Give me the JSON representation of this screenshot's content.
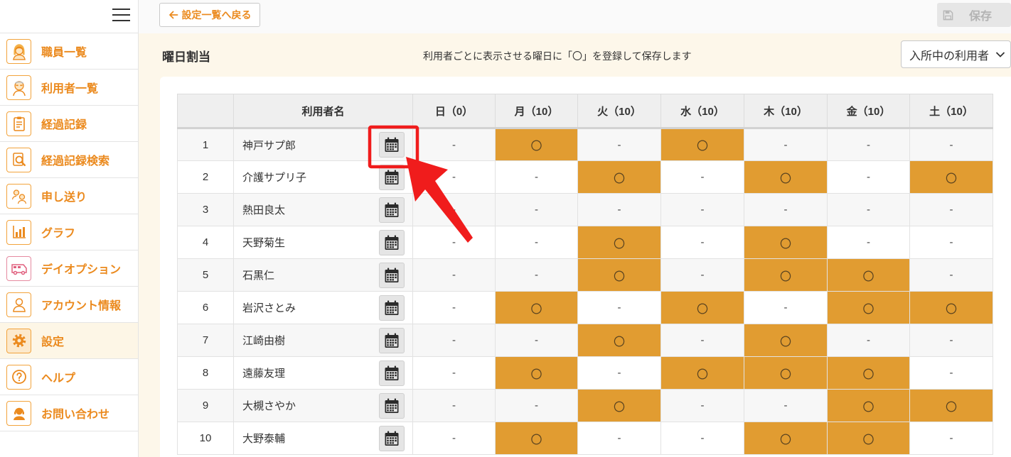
{
  "sidebar": {
    "menu_icon": "hamburger-icon",
    "items": [
      {
        "label": "職員一覧",
        "icon": "staff-icon"
      },
      {
        "label": "利用者一覧",
        "icon": "user-icon"
      },
      {
        "label": "経過記録",
        "icon": "clipboard-icon"
      },
      {
        "label": "経過記録検索",
        "icon": "record-search-icon"
      },
      {
        "label": "申し送り",
        "icon": "handover-icon"
      },
      {
        "label": "グラフ",
        "icon": "graph-icon"
      },
      {
        "label": "デイオプション",
        "icon": "van-icon"
      },
      {
        "label": "アカウント情報",
        "icon": "account-icon"
      },
      {
        "label": "設定",
        "icon": "gear-icon",
        "active": true
      },
      {
        "label": "ヘルプ",
        "icon": "help-icon"
      },
      {
        "label": "お問い合わせ",
        "icon": "contact-icon"
      }
    ]
  },
  "topbar": {
    "back_label": "設定一覧へ戻る",
    "back_icon": "arrow-left-icon",
    "save_label": "保存",
    "save_icon": "save-icon",
    "save_disabled": true
  },
  "page": {
    "title": "曜日割当",
    "description": "利用者ごとに表示させる曜日に「〇」を登録して保存します",
    "filter_selected": "入所中の利用者",
    "filter_icon": "chevron-down-icon"
  },
  "table": {
    "header_name": "利用者名",
    "header_days": [
      "日（0）",
      "月（10）",
      "火（10）",
      "水（10）",
      "木（10）",
      "金（10）",
      "土（10）"
    ],
    "row_action_icon": "calendar-icon",
    "rows": [
      {
        "no": "1",
        "name": "神戸サプ郎",
        "days": [
          "-",
          "〇",
          "-",
          "〇",
          "-",
          "-",
          "-"
        ]
      },
      {
        "no": "2",
        "name": "介護サプリ子",
        "days": [
          "-",
          "-",
          "〇",
          "-",
          "〇",
          "-",
          "〇"
        ]
      },
      {
        "no": "3",
        "name": "熱田良太",
        "days": [
          "-",
          "-",
          "-",
          "-",
          "-",
          "-",
          "-"
        ]
      },
      {
        "no": "4",
        "name": "天野菊生",
        "days": [
          "-",
          "-",
          "〇",
          "-",
          "〇",
          "-",
          "-"
        ]
      },
      {
        "no": "5",
        "name": "石黒仁",
        "days": [
          "-",
          "-",
          "〇",
          "-",
          "〇",
          "〇",
          "-"
        ]
      },
      {
        "no": "6",
        "name": "岩沢さとみ",
        "days": [
          "-",
          "〇",
          "-",
          "〇",
          "-",
          "〇",
          "〇"
        ]
      },
      {
        "no": "7",
        "name": "江崎由樹",
        "days": [
          "-",
          "-",
          "〇",
          "-",
          "〇",
          "-",
          "-"
        ]
      },
      {
        "no": "8",
        "name": "遠藤友理",
        "days": [
          "-",
          "〇",
          "-",
          "〇",
          "〇",
          "〇",
          "-"
        ]
      },
      {
        "no": "9",
        "name": "大槻さやか",
        "days": [
          "-",
          "-",
          "〇",
          "-",
          "-",
          "〇",
          "〇"
        ]
      },
      {
        "no": "10",
        "name": "大野泰輔",
        "days": [
          "-",
          "〇",
          "-",
          "-",
          "〇",
          "〇",
          "-"
        ]
      }
    ]
  },
  "colors": {
    "accent": "#eb8a1e",
    "selected_cell": "#e19c31",
    "annotation": "#f01c1c",
    "page_background": "#fdf7ea"
  }
}
